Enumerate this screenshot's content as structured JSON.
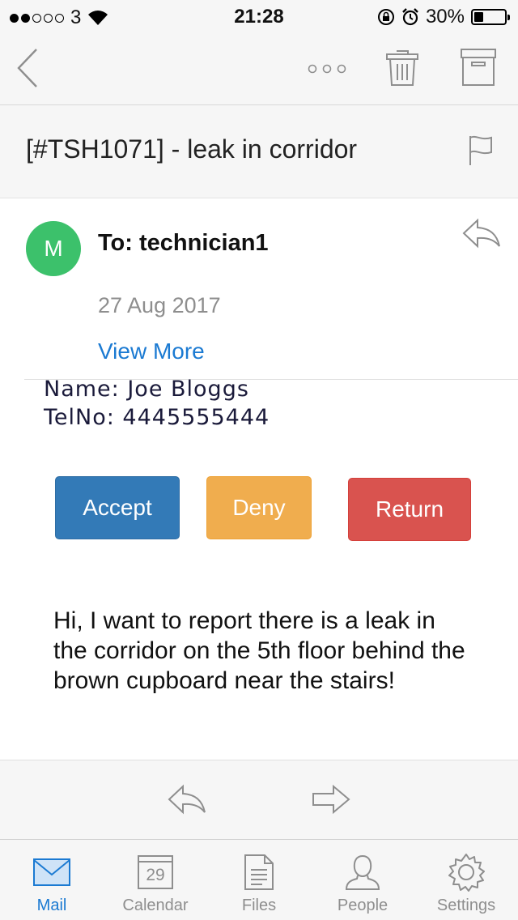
{
  "status_bar": {
    "carrier": "3",
    "time": "21:28",
    "battery": "30%",
    "battery_level": 0.3
  },
  "toolbar": {
    "back_icon": "chevron-left-icon",
    "more_icon": "more-dots-icon",
    "delete_icon": "trash-icon",
    "archive_icon": "archive-icon"
  },
  "email": {
    "subject": "[#TSH1071] - leak in corridor",
    "avatar_initial": "M",
    "to": "To: technician1",
    "date": "27 Aug 2017",
    "view_more": "View More",
    "name_line": "Name: Joe Bloggs",
    "tel_line": "TelNo: 4445555444",
    "buttons": {
      "accept": "Accept",
      "deny": "Deny",
      "return": "Return"
    },
    "message": "Hi, I want to report there is a leak in the corridor on the 5th floor behind the brown cupboard near the stairs!"
  },
  "colors": {
    "accept": "#337ab7",
    "deny": "#f0ad4e",
    "return": "#d9534f",
    "avatar": "#3cc16b",
    "link": "#1b7ad2"
  },
  "tabs": [
    {
      "label": "Mail",
      "icon": "mail-icon",
      "active": true
    },
    {
      "label": "Calendar",
      "icon": "calendar-icon",
      "day": "29"
    },
    {
      "label": "Files",
      "icon": "file-icon"
    },
    {
      "label": "People",
      "icon": "person-icon"
    },
    {
      "label": "Settings",
      "icon": "gear-icon"
    }
  ]
}
